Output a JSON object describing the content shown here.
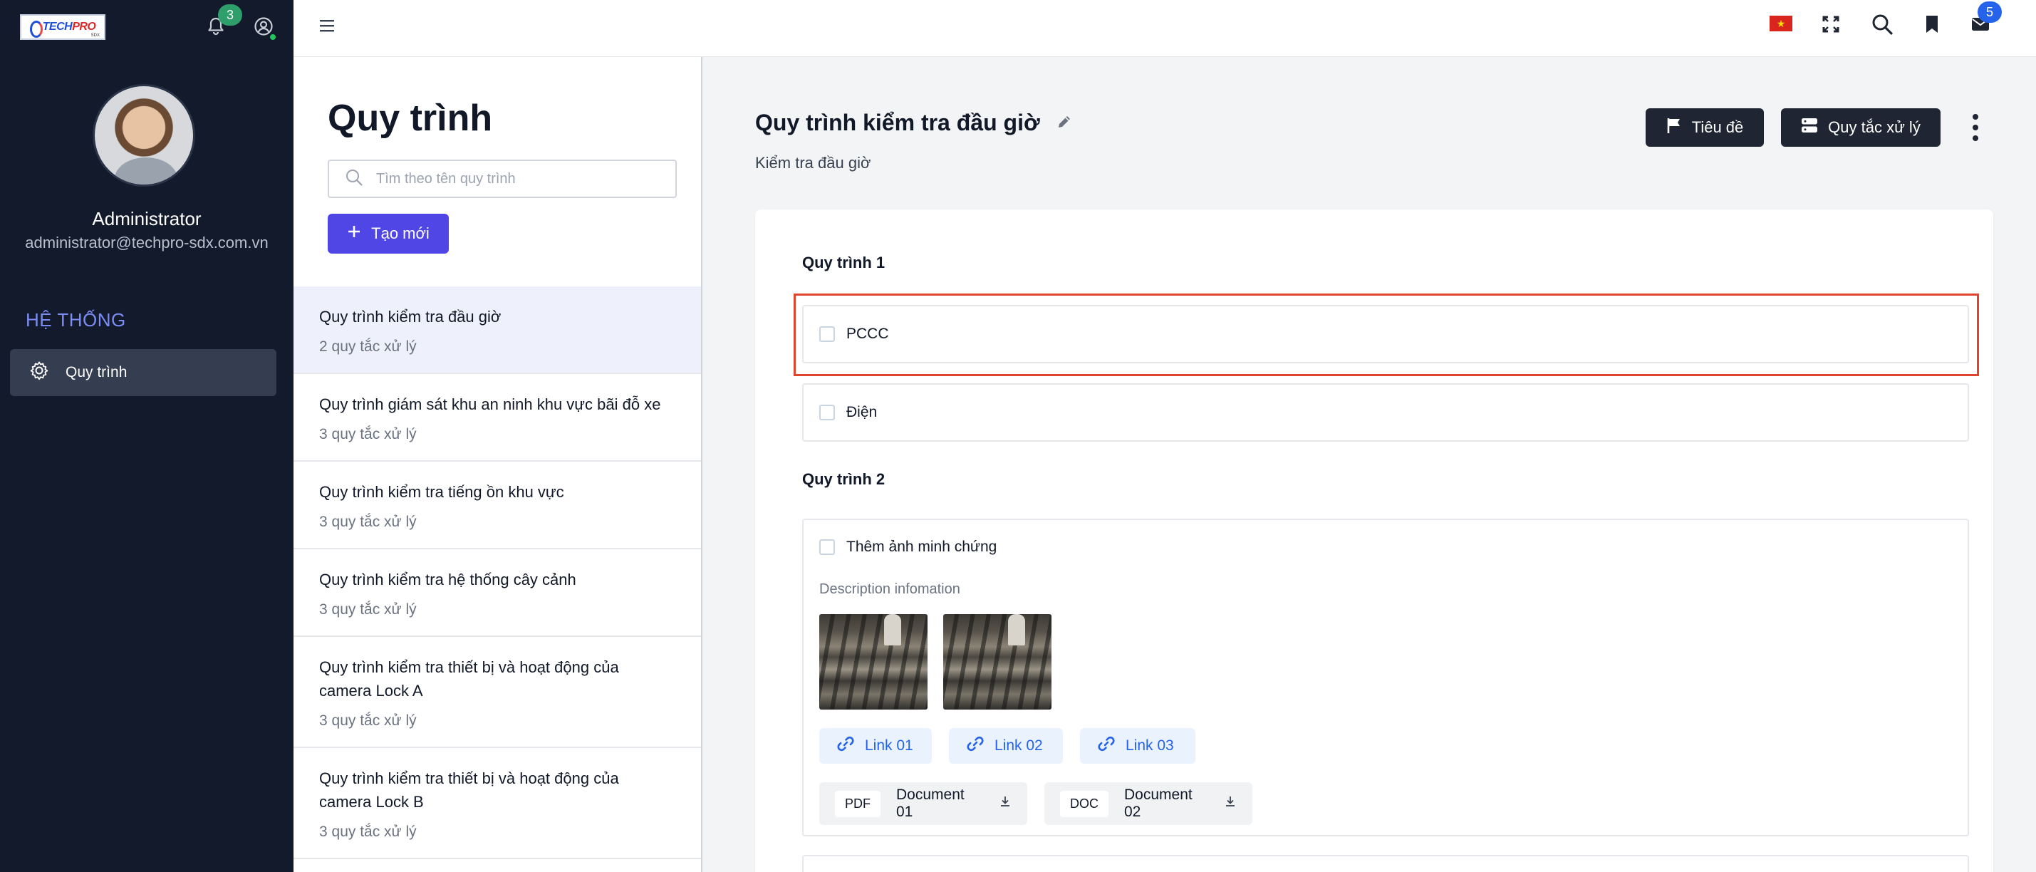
{
  "app": {
    "logo_text_a": "TECH",
    "logo_text_b": "PRO",
    "logo_sub": "SDX",
    "notification_count": "3",
    "mail_count": "5"
  },
  "sidebar": {
    "user_name": "Administrator",
    "user_email": "administrator@techpro-sdx.com.vn",
    "section_title": "HỆ THỐNG",
    "items": [
      {
        "label": "Quy trình",
        "icon": "gear-icon",
        "active": true
      }
    ]
  },
  "list": {
    "title": "Quy trình",
    "search_placeholder": "Tìm theo tên quy trình",
    "create_label": "Tạo mới",
    "processes": [
      {
        "name": "Quy trình kiểm tra đầu giờ",
        "rules": "2 quy tắc xử lý"
      },
      {
        "name": "Quy trình giám sát khu an ninh khu vực bãi đỗ xe",
        "rules": "3 quy tắc xử lý"
      },
      {
        "name": "Quy trình kiểm tra tiếng ồn khu vực",
        "rules": "3 quy tắc xử lý"
      },
      {
        "name": "Quy trình kiểm tra hệ thống cây cảnh",
        "rules": "3 quy tắc xử lý"
      },
      {
        "name": "Quy trình kiểm tra thiết bị và hoạt động của camera Lock A",
        "rules": "3 quy tắc xử lý"
      },
      {
        "name": "Quy trình kiểm tra thiết bị và hoạt động của camera Lock B",
        "rules": "3 quy tắc xử lý"
      }
    ]
  },
  "detail": {
    "title": "Quy trình kiểm tra đầu giờ",
    "subtitle": "Kiểm tra đầu giờ",
    "title_button": "Tiêu đề",
    "rules_button": "Quy tắc xử lý",
    "group1": {
      "title": "Quy trình 1",
      "tasks": [
        "PCCC",
        "Điện"
      ]
    },
    "group2": {
      "title": "Quy trình 2",
      "task": "Thêm ảnh minh chứng",
      "description": "Description infomation",
      "links": [
        "Link 01",
        "Link 02",
        "Link 03"
      ],
      "documents": [
        {
          "type": "PDF",
          "name": "Document 01"
        },
        {
          "type": "DOC",
          "name": "Document 02"
        }
      ]
    }
  },
  "colors": {
    "sidebar_bg": "#121a2b",
    "accent": "#4f46e5",
    "highlight_border": "#e0442c",
    "link_blue": "#2563eb"
  }
}
